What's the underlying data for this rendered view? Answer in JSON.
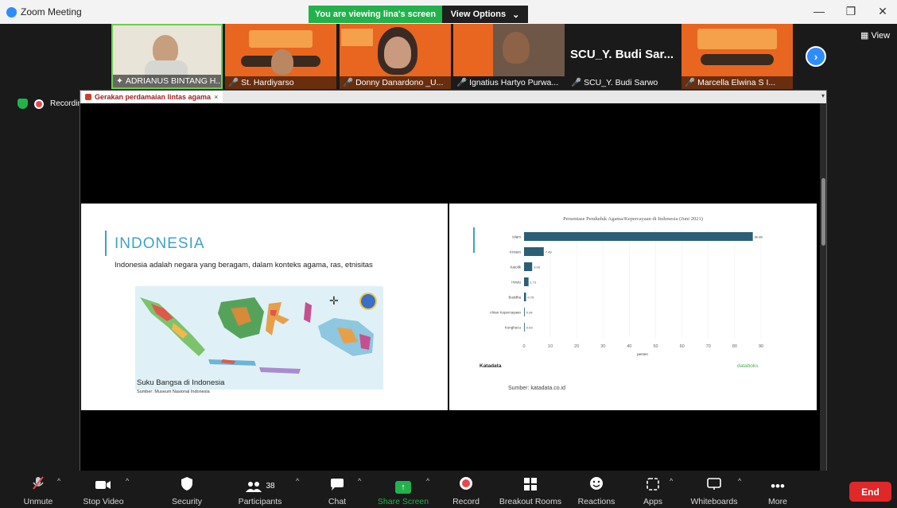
{
  "window": {
    "app_title": "Zoom Meeting",
    "share_banner": "You are viewing lina's screen",
    "view_options": "View Options",
    "view_options_caret": "⌄",
    "minimize": "—",
    "restore": "❐",
    "close": "✕"
  },
  "participants": [
    {
      "name": "ADRIANUS BINTANG H...",
      "mic_icon": "pin-icon"
    },
    {
      "name": "St. Hardiyarso",
      "mic_icon": "mic-muted-icon"
    },
    {
      "name": "Donny Danardono _U...",
      "mic_icon": "mic-muted-icon"
    },
    {
      "name": "Ignatius Hartyo Purwa...",
      "mic_icon": "mic-muted-icon"
    },
    {
      "name": "SCU_Y. Budi Sarwo",
      "mic_icon": "mic-muted-icon"
    },
    {
      "name": "Marcella Elwina S I...",
      "mic_icon": "mic-muted-icon"
    }
  ],
  "big_participant_name": "SCU_Y. Budi Sar...",
  "view_button": "View",
  "recording_label": "Recording",
  "browser_tab": "Gerakan perdamaian lintas agama",
  "browser_tab_close": "×",
  "slide_left": {
    "title": "INDONESIA",
    "text": "Indonesia adalah negara yang beragam, dalam konteks agama, ras, etnisitas",
    "map_caption": "Suku Bangsa di Indonesia",
    "map_source": "Sumber: Museum Nasional Indonesia"
  },
  "slide_right": {
    "brand_left": "Katadata",
    "brand_right": "databoks",
    "source": "Sumber: katadata.co.id"
  },
  "chart_data": {
    "type": "bar",
    "orientation": "horizontal",
    "title": "Persentase Penduduk Agama/Kepercayaan di Indonesia (Juni 2021)",
    "categories": [
      "Islam",
      "Kristen",
      "Katolik",
      "Hindu",
      "Buddha",
      "Aliran Kepercayaan",
      "Konghucu"
    ],
    "values": [
      86.88,
      7.49,
      3.09,
      1.71,
      0.75,
      0.04,
      0.03
    ],
    "value_labels": [
      "86.88",
      "7.49",
      "3.09",
      "1.71",
      "0.75",
      "0.04",
      "0.03"
    ],
    "xlim": [
      0,
      90
    ],
    "xticks": [
      "0",
      "10",
      "20",
      "30",
      "40",
      "50",
      "60",
      "70",
      "80",
      "90"
    ],
    "xlabel": "persen",
    "bar_color": "#2b5f75"
  },
  "toolbar": {
    "unmute": "Unmute",
    "stop_video": "Stop Video",
    "security": "Security",
    "participants": "Participants",
    "participants_count": "38",
    "chat": "Chat",
    "share_screen": "Share Screen",
    "record": "Record",
    "breakout_rooms": "Breakout Rooms",
    "reactions": "Reactions",
    "apps": "Apps",
    "whiteboards": "Whiteboards",
    "more": "More",
    "end": "End"
  },
  "colors": {
    "zoom_blue": "#2d8cff",
    "share_green": "#22b24c",
    "end_red": "#e02828",
    "slide_accent": "#3ea1c8",
    "banner_orange": "#e8661f"
  }
}
